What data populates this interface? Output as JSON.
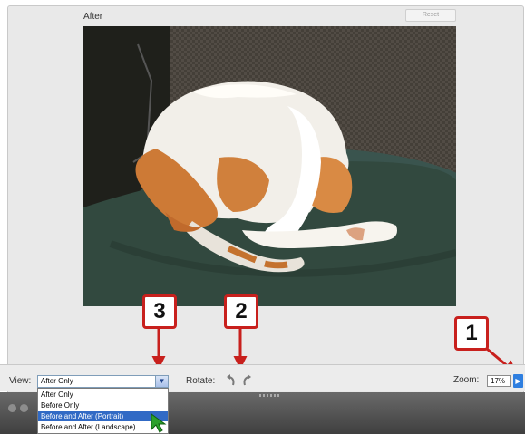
{
  "preview": {
    "panel_title": "After",
    "reset_label": "Reset"
  },
  "callouts": [
    {
      "number": "3"
    },
    {
      "number": "2"
    },
    {
      "number": "1"
    }
  ],
  "controls": {
    "view_label": "View:",
    "view_value": "After Only",
    "view_options": [
      {
        "label": "After Only",
        "selected": false
      },
      {
        "label": "Before Only",
        "selected": false
      },
      {
        "label": "Before and After (Portrait)",
        "selected": true
      },
      {
        "label": "Before and After (Landscape)",
        "selected": false
      }
    ],
    "rotate_label": "Rotate:",
    "zoom_label": "Zoom:",
    "zoom_value": "17%"
  },
  "colors": {
    "callout_border": "#c8201d",
    "selection": "#316ac5",
    "zoom_arrow": "#2f7fe0"
  }
}
